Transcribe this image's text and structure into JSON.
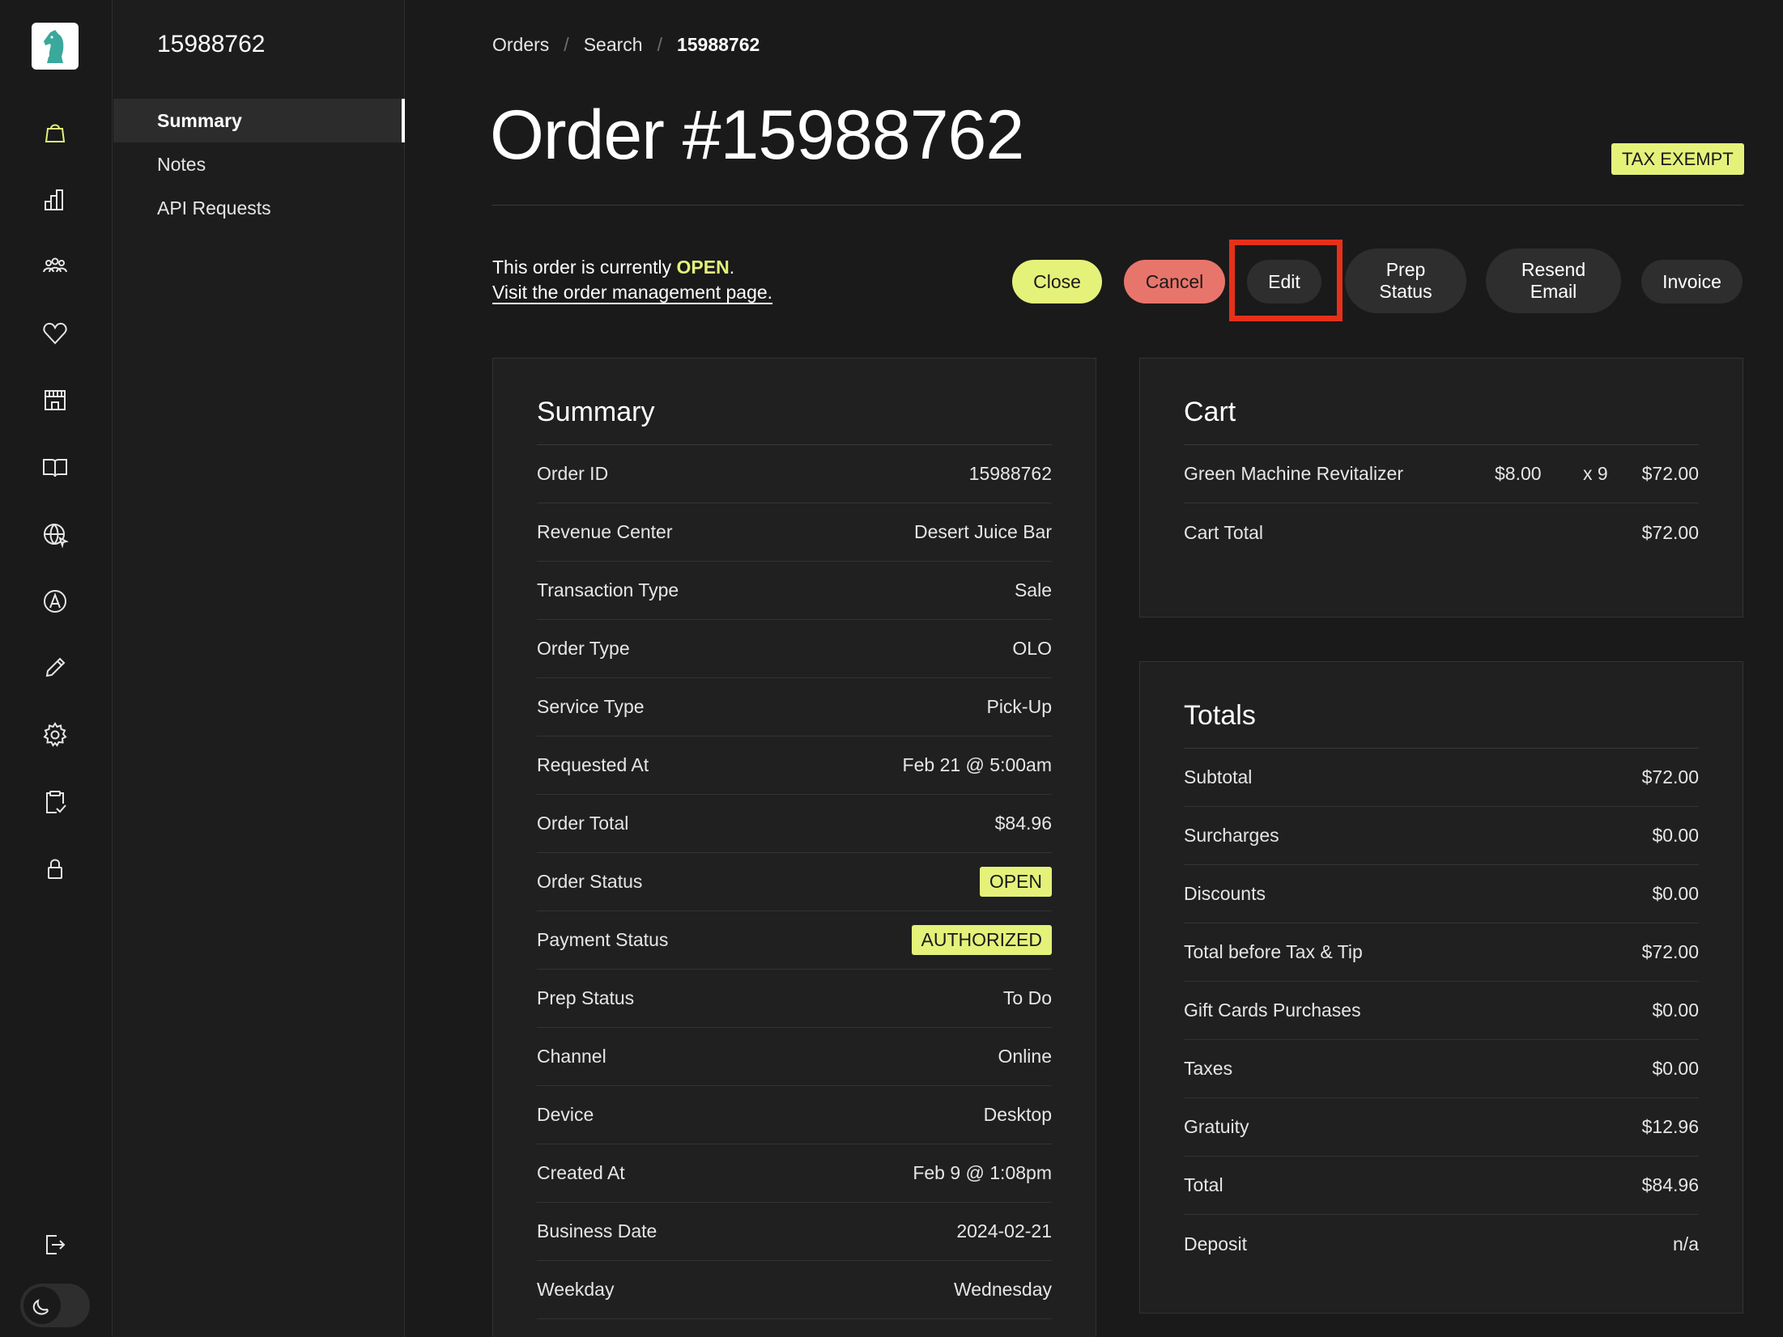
{
  "subnav": {
    "title": "15988762",
    "items": [
      {
        "label": "Summary"
      },
      {
        "label": "Notes"
      },
      {
        "label": "API Requests"
      }
    ]
  },
  "breadcrumb": {
    "items": [
      "Orders",
      "Search",
      "15988762"
    ],
    "separator": "/"
  },
  "header": {
    "title": "Order #15988762",
    "badge": "TAX EXEMPT"
  },
  "status": {
    "prefix": "This order is currently ",
    "state": "OPEN",
    "suffix": ".",
    "link": "Visit the order management page."
  },
  "actions": {
    "close": "Close",
    "cancel": "Cancel",
    "edit": "Edit",
    "prep_status_1": "Prep",
    "prep_status_2": "Status",
    "resend_1": "Resend",
    "resend_2": "Email",
    "invoice": "Invoice"
  },
  "summary": {
    "title": "Summary",
    "rows": [
      {
        "label": "Order ID",
        "value": "15988762"
      },
      {
        "label": "Revenue Center",
        "value": "Desert Juice Bar"
      },
      {
        "label": "Transaction Type",
        "value": "Sale"
      },
      {
        "label": "Order Type",
        "value": "OLO"
      },
      {
        "label": "Service Type",
        "value": "Pick-Up"
      },
      {
        "label": "Requested At",
        "value": "Feb 21 @ 5:00am"
      },
      {
        "label": "Order Total",
        "value": "$84.96"
      },
      {
        "label": "Order Status",
        "value": "OPEN"
      },
      {
        "label": "Payment Status",
        "value": "AUTHORIZED"
      },
      {
        "label": "Prep Status",
        "value": "To Do"
      },
      {
        "label": "Channel",
        "value": "Online"
      },
      {
        "label": "Device",
        "value": "Desktop"
      },
      {
        "label": "Created At",
        "value": "Feb 9 @ 1:08pm"
      },
      {
        "label": "Business Date",
        "value": "2024-02-21"
      },
      {
        "label": "Weekday",
        "value": "Wednesday"
      }
    ]
  },
  "cart": {
    "title": "Cart",
    "item": {
      "name": "Green Machine Revitalizer",
      "price": "$8.00",
      "qty": "x 9",
      "total": "$72.00"
    },
    "total_label": "Cart Total",
    "total_value": "$72.00"
  },
  "totals": {
    "title": "Totals",
    "rows": [
      {
        "label": "Subtotal",
        "value": "$72.00"
      },
      {
        "label": "Surcharges",
        "value": "$0.00"
      },
      {
        "label": "Discounts",
        "value": "$0.00"
      },
      {
        "label": "Total before Tax & Tip",
        "value": "$72.00"
      },
      {
        "label": "Gift Cards Purchases",
        "value": "$0.00"
      },
      {
        "label": "Taxes",
        "value": "$0.00"
      },
      {
        "label": "Gratuity",
        "value": "$12.96"
      },
      {
        "label": "Total",
        "value": "$84.96"
      },
      {
        "label": "Deposit",
        "value": "n/a"
      }
    ]
  },
  "icons": {
    "rail": [
      "orders-bag-icon",
      "reports-chart-icon",
      "customers-icon",
      "loyalty-heart-icon",
      "stores-icon",
      "menus-book-icon",
      "web-icon",
      "accounts-icon",
      "design-pencil-icon",
      "settings-gear-icon",
      "clipboard-check-icon",
      "lock-icon",
      "logout-icon",
      "moon-icon"
    ]
  },
  "colors": {
    "accent": "#e4f27a",
    "danger": "#e8756b",
    "highlight": "#e6311a",
    "background": "#1a1a1a"
  }
}
